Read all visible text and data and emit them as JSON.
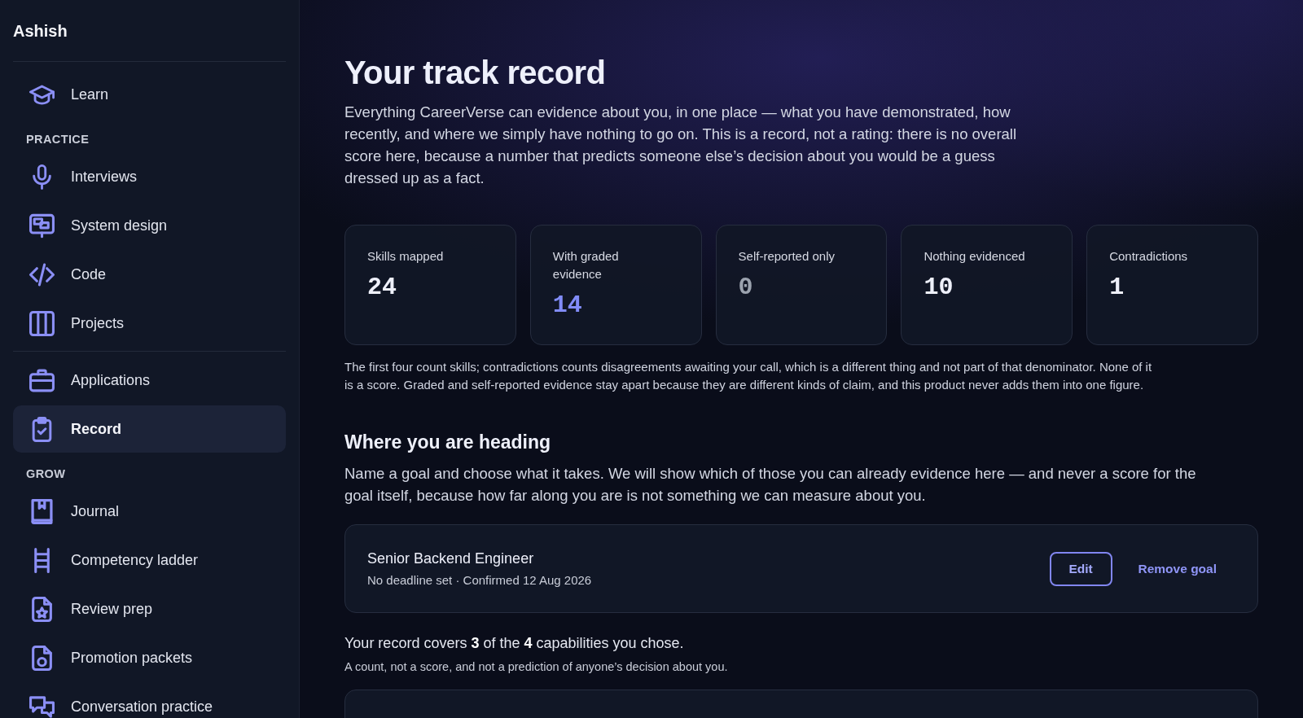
{
  "sidebar": {
    "user_name": "Ashish",
    "sections": [
      {
        "items": [
          {
            "label": "Learn",
            "selected": false
          }
        ]
      },
      {
        "heading": "PRACTICE",
        "items": [
          {
            "label": "Interviews",
            "selected": false
          },
          {
            "label": "System design",
            "selected": false
          },
          {
            "label": "Code",
            "selected": false
          },
          {
            "label": "Projects",
            "selected": false
          }
        ]
      },
      {
        "items": [
          {
            "label": "Applications",
            "selected": false
          },
          {
            "label": "Record",
            "selected": true
          }
        ]
      },
      {
        "heading": "GROW",
        "items": [
          {
            "label": "Journal",
            "selected": false
          },
          {
            "label": "Competency ladder",
            "selected": false
          },
          {
            "label": "Review prep",
            "selected": false
          },
          {
            "label": "Promotion packets",
            "selected": false
          },
          {
            "label": "Conversation practice",
            "selected": false
          }
        ]
      }
    ]
  },
  "header": {
    "title": "Your track record",
    "intro": "Everything CareerVerse can evidence about you, in one place — what you have demonstrated, how recently, and where we simply have nothing to go on. This is a record, not a rating: there is no overall score here, because a number that predicts someone else’s decision about you would be a guess dressed up as a fact."
  },
  "stats": [
    {
      "label": "Skills mapped",
      "value": "24",
      "color": "#eef0fa"
    },
    {
      "label": "With graded evidence",
      "value": "14",
      "color": "#818cf8"
    },
    {
      "label": "Self-reported only",
      "value": "0",
      "color": "#9ca3af"
    },
    {
      "label": "Nothing evidenced",
      "value": "10",
      "color": "#eef0fa"
    },
    {
      "label": "Contradictions",
      "value": "1",
      "color": "#eef0fa"
    }
  ],
  "stats_note": "The first four count skills; contradictions counts disagreements awaiting your call, which is a different thing and not part of that denominator. None of it is a score. Graded and self-reported evidence stay apart because they are different kinds of claim, and this product never adds them into one figure.",
  "goals": {
    "heading": "Where you are heading",
    "description": "Name a goal and choose what it takes. We will show which of those you can already evidence here — and never a score for the goal itself, because how far along you are is not something we can measure about you.",
    "goal": {
      "title": "Senior Backend Engineer",
      "meta": "No deadline set · Confirmed 12 Aug 2026",
      "edit_label": "Edit",
      "remove_label": "Remove goal"
    },
    "coverage": "Your record covers **3** of the **4** capabilities you chose.",
    "coverage_note": "A count, not a score, and not a prediction of anyone’s decision about you."
  }
}
